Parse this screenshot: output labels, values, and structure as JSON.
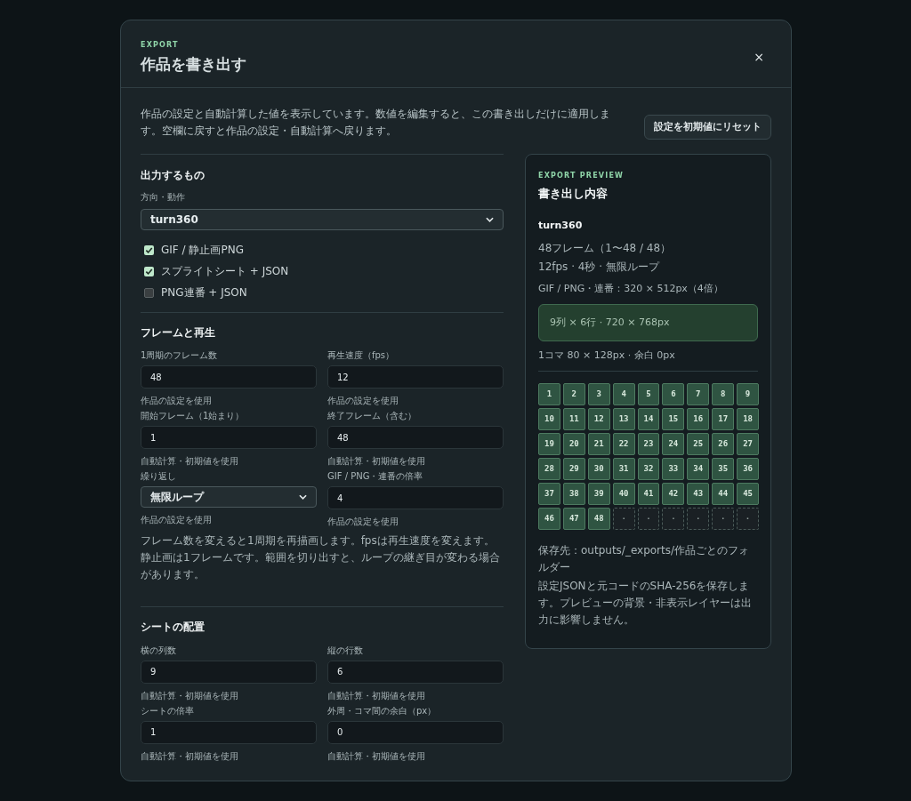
{
  "dialog": {
    "eyebrow": "EXPORT",
    "title": "作品を書き出す",
    "close": "×"
  },
  "intro": {
    "text": "作品の設定と自動計算した値を表示しています。数値を編集すると、この書き出しだけに適用します。空欄に戻すと作品の設定・自動計算へ戻ります。",
    "reset_button": "設定を初期値にリセット"
  },
  "sections": [
    {
      "title": "出力するもの",
      "items": [
        {
          "kind": "select",
          "label": "方向・動作",
          "value": "turn360"
        },
        {
          "kind": "checkbox",
          "label": "GIF / 静止画PNG",
          "checked": true
        },
        {
          "kind": "checkbox",
          "label": "スプライトシート + JSON",
          "checked": true
        },
        {
          "kind": "checkbox",
          "label": "PNG連番 + JSON",
          "checked": false
        }
      ]
    },
    {
      "title": "フレームと再生",
      "items": [
        {
          "kind": "fields",
          "fields": [
            {
              "kind": "input",
              "label": "1周期のフレーム数",
              "value": "48",
              "hint": "作品の設定を使用"
            },
            {
              "kind": "input",
              "label": "再生速度（fps）",
              "value": "12",
              "hint": "作品の設定を使用"
            },
            {
              "kind": "input",
              "label": "開始フレーム（1始まり）",
              "value": "1",
              "hint": "自動計算・初期値を使用"
            },
            {
              "kind": "input",
              "label": "終了フレーム（含む）",
              "value": "48",
              "hint": "自動計算・初期値を使用"
            },
            {
              "kind": "select",
              "label": "繰り返し",
              "value": "無限ループ",
              "hint": "作品の設定を使用"
            },
            {
              "kind": "input",
              "label": "GIF / PNG・連番の倍率",
              "value": "4",
              "hint": "作品の設定を使用"
            }
          ]
        },
        {
          "kind": "note",
          "text": "フレーム数を変えると1周期を再描画します。fpsは再生速度を変えます。静止画は1フレームです。範囲を切り出すと、ループの継ぎ目が変わる場合があります。"
        }
      ]
    },
    {
      "title": "シートの配置",
      "items": [
        {
          "kind": "fields",
          "fields": [
            {
              "kind": "input",
              "label": "横の列数",
              "value": "9",
              "hint": "自動計算・初期値を使用"
            },
            {
              "kind": "input",
              "label": "縦の行数",
              "value": "6",
              "hint": "自動計算・初期値を使用"
            },
            {
              "kind": "input",
              "label": "シートの倍率",
              "value": "1",
              "hint": "自動計算・初期値を使用"
            },
            {
              "kind": "input",
              "label": "外周・コマ間の余白（px）",
              "value": "0",
              "hint": "自動計算・初期値を使用"
            }
          ]
        }
      ]
    }
  ],
  "preview": {
    "eyebrow": "EXPORT PREVIEW",
    "title": "書き出し内容",
    "name": "turn360",
    "lines": [
      "48フレーム（1〜48 / 48）",
      "12fps · 4秒 · 無限ループ"
    ],
    "gif_size": "GIF / PNG・連番：320 × 512px（4倍）",
    "sheet_size": "9列 × 6行 · 720 × 768px",
    "cell_info": "1コマ 80 × 128px · 余白 0px",
    "cells": [
      {
        "label": "1",
        "filled": true
      },
      {
        "label": "2",
        "filled": true
      },
      {
        "label": "3",
        "filled": true
      },
      {
        "label": "4",
        "filled": true
      },
      {
        "label": "5",
        "filled": true
      },
      {
        "label": "6",
        "filled": true
      },
      {
        "label": "7",
        "filled": true
      },
      {
        "label": "8",
        "filled": true
      },
      {
        "label": "9",
        "filled": true
      },
      {
        "label": "10",
        "filled": true
      },
      {
        "label": "11",
        "filled": true
      },
      {
        "label": "12",
        "filled": true
      },
      {
        "label": "13",
        "filled": true
      },
      {
        "label": "14",
        "filled": true
      },
      {
        "label": "15",
        "filled": true
      },
      {
        "label": "16",
        "filled": true
      },
      {
        "label": "17",
        "filled": true
      },
      {
        "label": "18",
        "filled": true
      },
      {
        "label": "19",
        "filled": true
      },
      {
        "label": "20",
        "filled": true
      },
      {
        "label": "21",
        "filled": true
      },
      {
        "label": "22",
        "filled": true
      },
      {
        "label": "23",
        "filled": true
      },
      {
        "label": "24",
        "filled": true
      },
      {
        "label": "25",
        "filled": true
      },
      {
        "label": "26",
        "filled": true
      },
      {
        "label": "27",
        "filled": true
      },
      {
        "label": "28",
        "filled": true
      },
      {
        "label": "29",
        "filled": true
      },
      {
        "label": "30",
        "filled": true
      },
      {
        "label": "31",
        "filled": true
      },
      {
        "label": "32",
        "filled": true
      },
      {
        "label": "33",
        "filled": true
      },
      {
        "label": "34",
        "filled": true
      },
      {
        "label": "35",
        "filled": true
      },
      {
        "label": "36",
        "filled": true
      },
      {
        "label": "37",
        "filled": true
      },
      {
        "label": "38",
        "filled": true
      },
      {
        "label": "39",
        "filled": true
      },
      {
        "label": "40",
        "filled": true
      },
      {
        "label": "41",
        "filled": true
      },
      {
        "label": "42",
        "filled": true
      },
      {
        "label": "43",
        "filled": true
      },
      {
        "label": "44",
        "filled": true
      },
      {
        "label": "45",
        "filled": true
      },
      {
        "label": "46",
        "filled": true
      },
      {
        "label": "47",
        "filled": true
      },
      {
        "label": "48",
        "filled": true
      },
      {
        "label": "·",
        "filled": false
      },
      {
        "label": "·",
        "filled": false
      },
      {
        "label": "·",
        "filled": false
      },
      {
        "label": "·",
        "filled": false
      },
      {
        "label": "·",
        "filled": false
      },
      {
        "label": "·",
        "filled": false
      }
    ],
    "footer": [
      "保存先：outputs/_exports/作品ごとのフォルダー",
      "設定JSONと元コードのSHA-256を保存します。プレビューの背景・非表示レイヤーは出力に影響しません。"
    ]
  }
}
